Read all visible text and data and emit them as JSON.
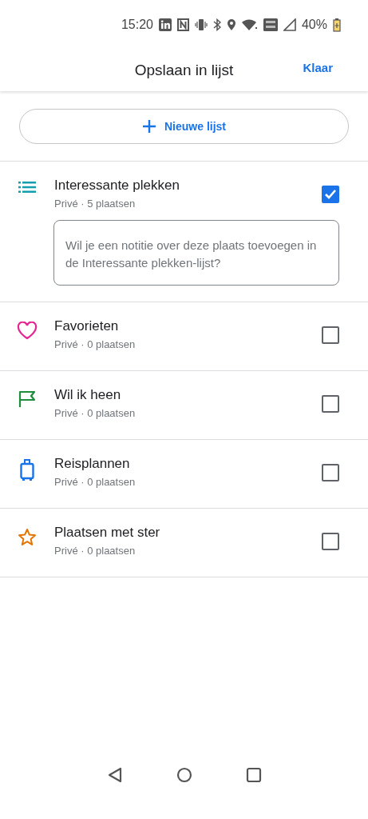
{
  "status_bar": {
    "time": "15:20",
    "battery": "40%"
  },
  "header": {
    "title": "Opslaan in lijst",
    "done": "Klaar"
  },
  "new_list_button": {
    "label": "Nieuwe lijst"
  },
  "lists": [
    {
      "kind": "list",
      "color": "#129eaf",
      "title": "Interessante plekken",
      "subtitle": "Privé · 5 plaatsen",
      "checked": true,
      "note": {
        "placeholder": "Wil je een notitie over deze plaats toevoegen in de Interessante plekken-lijst?"
      }
    },
    {
      "kind": "heart",
      "color": "#e52592",
      "title": "Favorieten",
      "subtitle": "Privé · 0 plaatsen",
      "checked": false
    },
    {
      "kind": "flag",
      "color": "#1e8e3e",
      "title": "Wil ik heen",
      "subtitle": "Privé · 0 plaatsen",
      "checked": false
    },
    {
      "kind": "suitcase",
      "color": "#1a73e8",
      "title": "Reisplannen",
      "subtitle": "Privé · 0 plaatsen",
      "checked": false
    },
    {
      "kind": "star",
      "color": "#e37400",
      "title": "Plaatsen met ster",
      "subtitle": "Privé · 0 plaatsen",
      "checked": false
    }
  ]
}
